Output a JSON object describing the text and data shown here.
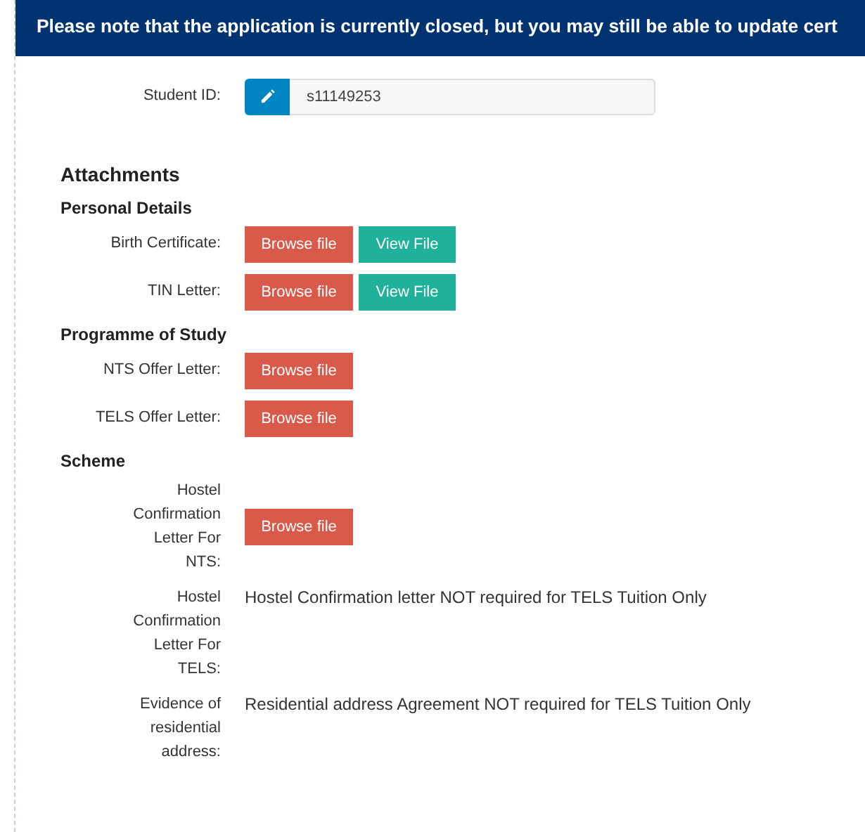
{
  "banner": {
    "text": "Please note that the application is currently closed, but you may still be able to update cert"
  },
  "student_id": {
    "label": "Student ID:",
    "value": "s11149253"
  },
  "attachments": {
    "title": "Attachments",
    "sections": [
      {
        "title": "Personal Details",
        "rows": [
          {
            "label": "Birth Certificate:",
            "kind": "buttons",
            "buttons": [
              {
                "label": "Browse file",
                "kind": "browse"
              },
              {
                "label": "View File",
                "kind": "view"
              }
            ]
          },
          {
            "label": "TIN Letter:",
            "kind": "buttons",
            "buttons": [
              {
                "label": "Browse file",
                "kind": "browse"
              },
              {
                "label": "View File",
                "kind": "view"
              }
            ]
          }
        ]
      },
      {
        "title": "Programme of Study",
        "rows": [
          {
            "label": "NTS Offer Letter:",
            "kind": "buttons",
            "buttons": [
              {
                "label": "Browse file",
                "kind": "browse"
              }
            ]
          },
          {
            "label": "TELS Offer Letter:",
            "kind": "buttons",
            "buttons": [
              {
                "label": "Browse file",
                "kind": "browse"
              }
            ]
          }
        ]
      },
      {
        "title": "Scheme",
        "rows": [
          {
            "label": "Hostel Confirmation Letter For NTS:",
            "kind": "buttons",
            "buttons": [
              {
                "label": "Browse file",
                "kind": "browse"
              }
            ]
          },
          {
            "label": "Hostel Confirmation Letter For TELS:",
            "kind": "note",
            "note": "Hostel Confirmation letter NOT required for TELS Tuition Only"
          },
          {
            "label": "Evidence of residential address:",
            "kind": "note",
            "note": "Residential address Agreement NOT required for TELS Tuition Only"
          }
        ]
      }
    ]
  }
}
